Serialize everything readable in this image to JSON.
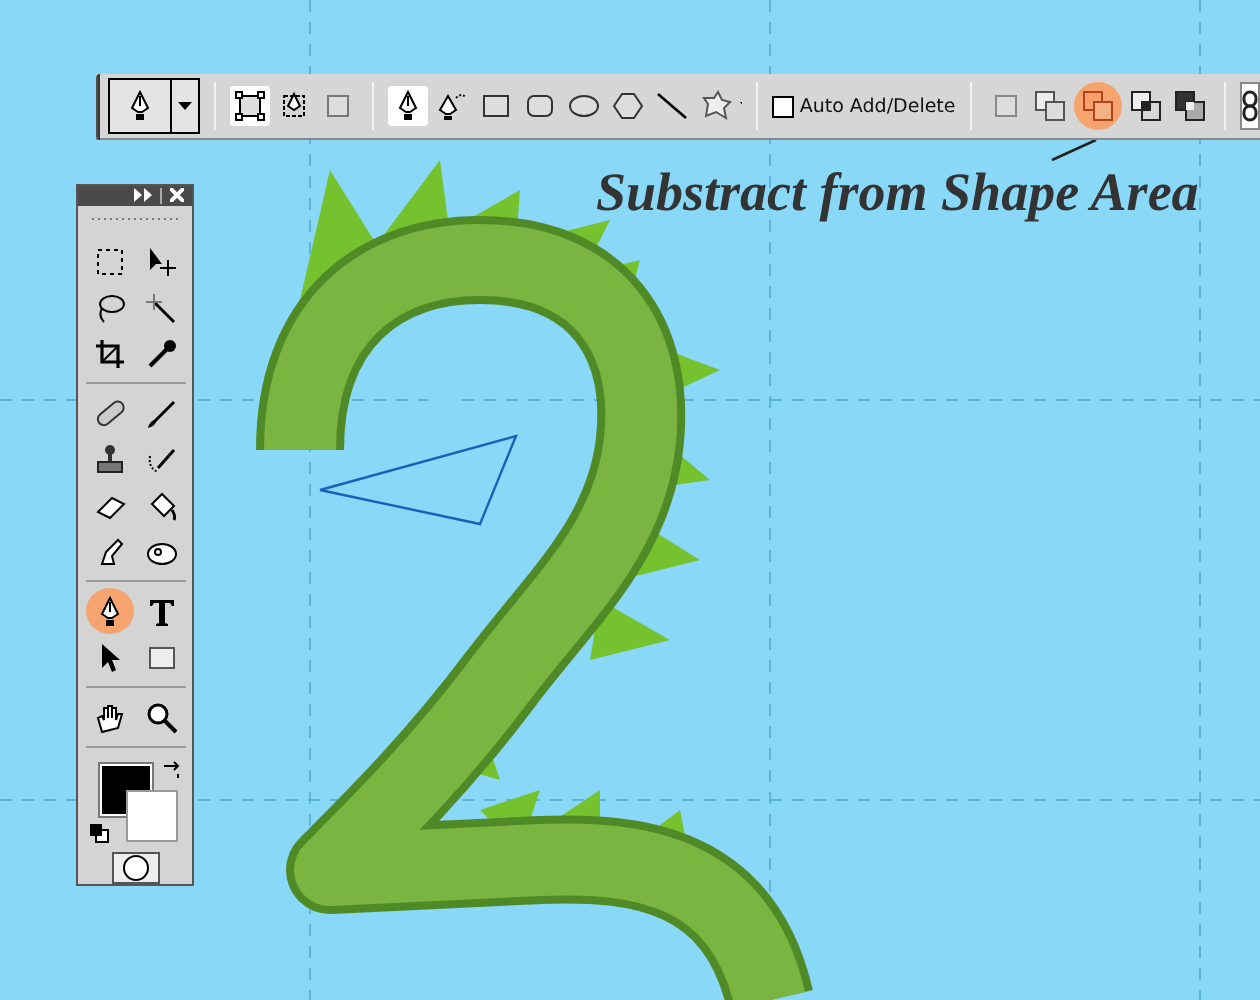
{
  "toolbar": {
    "preset": {
      "kind": "pen"
    },
    "modes": [
      {
        "kind": "shape-layers",
        "selected": true
      },
      {
        "kind": "paths",
        "selected": false
      },
      {
        "kind": "fill-pixels",
        "selected": false
      }
    ],
    "tools": [
      {
        "kind": "pen",
        "selected": true
      },
      {
        "kind": "freeform-pen",
        "selected": false
      },
      {
        "kind": "rectangle",
        "selected": false
      },
      {
        "kind": "rounded-rectangle",
        "selected": false
      },
      {
        "kind": "ellipse",
        "selected": false
      },
      {
        "kind": "polygon",
        "selected": false
      },
      {
        "kind": "line",
        "selected": false
      },
      {
        "kind": "custom-shape",
        "selected": false
      }
    ],
    "auto_add_delete": {
      "label": "Auto Add/Delete",
      "checked": false
    },
    "operations": [
      {
        "kind": "new",
        "highlighted": false
      },
      {
        "kind": "add",
        "highlighted": false
      },
      {
        "kind": "subtract",
        "highlighted": true
      },
      {
        "kind": "intersect",
        "highlighted": false
      },
      {
        "kind": "exclude",
        "highlighted": false
      }
    ]
  },
  "callout": {
    "text": "Substract from Shape Area"
  },
  "tools_panel": {
    "groups": [
      [
        {
          "kind": "marquee",
          "highlighted": false
        },
        {
          "kind": "move",
          "highlighted": false
        },
        {
          "kind": "lasso",
          "highlighted": false
        },
        {
          "kind": "magic-wand",
          "highlighted": false
        },
        {
          "kind": "crop",
          "highlighted": false
        },
        {
          "kind": "eyedropper",
          "highlighted": false
        }
      ],
      [
        {
          "kind": "bandage",
          "highlighted": false
        },
        {
          "kind": "brush",
          "highlighted": false
        },
        {
          "kind": "stamp",
          "highlighted": false
        },
        {
          "kind": "history-brush",
          "highlighted": false
        },
        {
          "kind": "eraser",
          "highlighted": false
        },
        {
          "kind": "bucket",
          "highlighted": false
        },
        {
          "kind": "finger",
          "highlighted": false
        },
        {
          "kind": "sponge",
          "highlighted": false
        }
      ],
      [
        {
          "kind": "pen",
          "highlighted": true
        },
        {
          "kind": "type",
          "highlighted": false
        },
        {
          "kind": "arrow",
          "highlighted": false
        },
        {
          "kind": "shape",
          "highlighted": false
        }
      ],
      [
        {
          "kind": "hand",
          "highlighted": false
        },
        {
          "kind": "zoom",
          "highlighted": false
        }
      ]
    ]
  }
}
